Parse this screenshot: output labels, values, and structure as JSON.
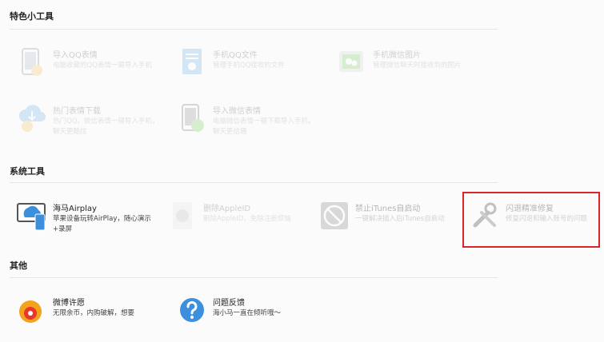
{
  "sections": {
    "special": {
      "title": "特色小工具"
    },
    "system": {
      "title": "系统工具"
    },
    "other": {
      "title": "其他"
    }
  },
  "tools": {
    "import_qq_emoji": {
      "title": "导入QQ表情",
      "desc": "电脑收藏的QQ表情一键导入手机"
    },
    "phone_qq_files": {
      "title": "手机QQ文件",
      "desc": "管理手机QQ接收的文件"
    },
    "phone_wechat_images": {
      "title": "手机微信图片",
      "desc": "管理微信聊天时接收到的图片"
    },
    "hot_emoji_download": {
      "title": "热门表情下载",
      "desc": "热门QQ、微信表情一键导入手机，聊天更酷炫"
    },
    "import_wechat_emoji": {
      "title": "导入微信表情",
      "desc": "电脑微信表情一键下载导入手机，聊天更给趣"
    },
    "haima_airplay": {
      "title": "海马Airplay",
      "desc": "苹果设备玩转AirPlay，随心演示+录屏"
    },
    "delete_appleid": {
      "title": "删除AppleID",
      "desc": "删除AppleID，免除注册烦恼"
    },
    "disable_itunes_autostart": {
      "title": "禁止iTunes自启动",
      "desc": "一键解决插入后iTunes自启动"
    },
    "crash_repair": {
      "title": "闪退精准修复",
      "desc": "修复闪退和输入账号的问题"
    },
    "weibo_wish": {
      "title": "微博许愿",
      "desc": "无限余币，内购破解，想要"
    },
    "feedback": {
      "title": "问题反馈",
      "desc": "海小马一直在倾听哦～"
    }
  },
  "colors": {
    "highlight": "#d9262b",
    "accent_blue": "#3b8fdc",
    "wechat_green": "#56c13b",
    "weibo_orange": "#f4a21b"
  }
}
